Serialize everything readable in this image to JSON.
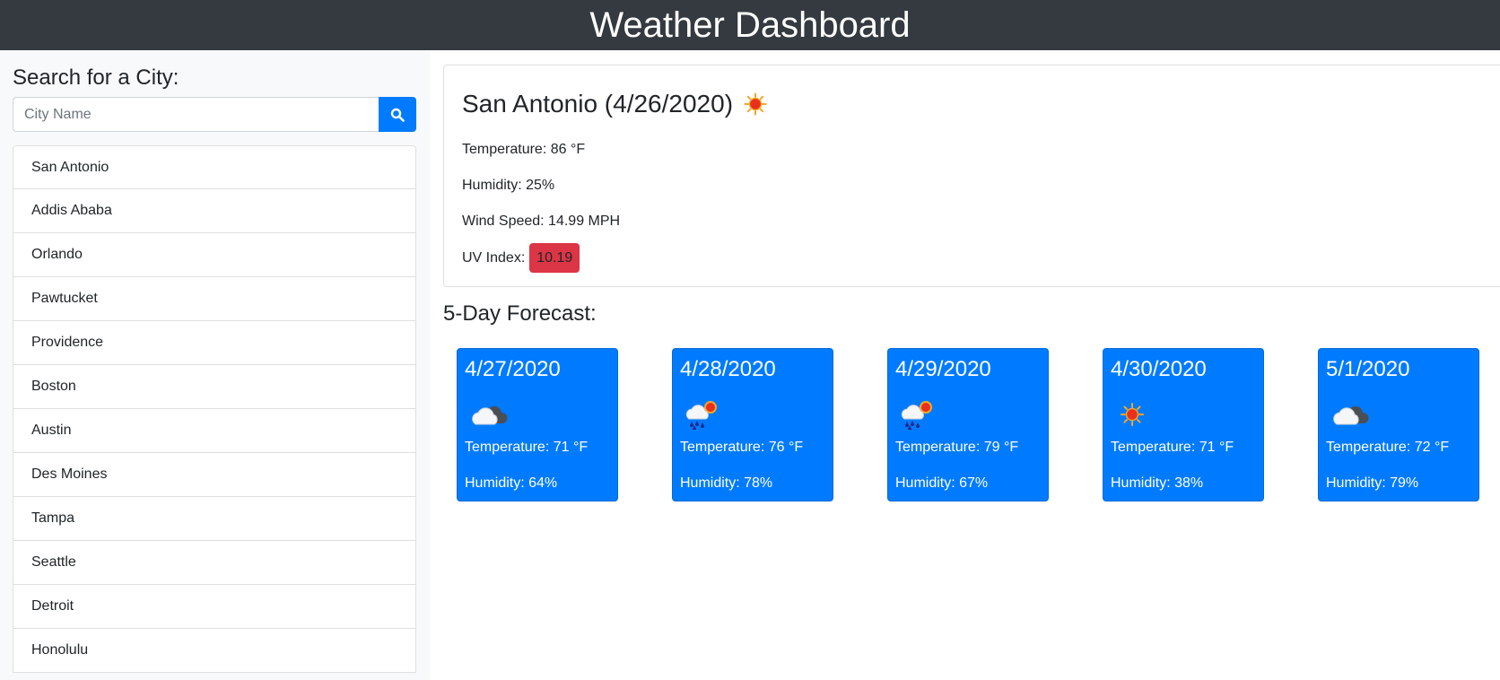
{
  "header": {
    "title": "Weather Dashboard"
  },
  "search": {
    "heading": "Search for a City:",
    "placeholder": "City Name",
    "button_icon": "search-icon"
  },
  "cities": [
    "San Antonio",
    "Addis Ababa",
    "Orlando",
    "Pawtucket",
    "Providence",
    "Boston",
    "Austin",
    "Des Moines",
    "Tampa",
    "Seattle",
    "Detroit",
    "Honolulu"
  ],
  "current": {
    "title": "San Antonio (4/26/2020)",
    "icon": "sun-icon",
    "temperature": "Temperature: 86 °F",
    "humidity": "Humidity: 25%",
    "wind": "Wind Speed: 14.99 MPH",
    "uv_label": "UV Index:",
    "uv_value": "10.19",
    "uv_color": "#dc3545"
  },
  "forecast": {
    "heading": "5-Day Forecast:",
    "days": [
      {
        "date": "4/27/2020",
        "icon": "cloud-icon",
        "temperature": "Temperature: 71 °F",
        "humidity": "Humidity: 64%"
      },
      {
        "date": "4/28/2020",
        "icon": "rain-sun-icon",
        "temperature": "Temperature: 76 °F",
        "humidity": "Humidity: 78%"
      },
      {
        "date": "4/29/2020",
        "icon": "rain-sun-icon",
        "temperature": "Temperature: 79 °F",
        "humidity": "Humidity: 67%"
      },
      {
        "date": "4/30/2020",
        "icon": "sun-icon",
        "temperature": "Temperature: 71 °F",
        "humidity": "Humidity: 38%"
      },
      {
        "date": "5/1/2020",
        "icon": "cloud-icon",
        "temperature": "Temperature: 72 °F",
        "humidity": "Humidity: 79%"
      }
    ]
  },
  "colors": {
    "navbar": "#343a40",
    "primary": "#007bff",
    "danger": "#dc3545"
  }
}
